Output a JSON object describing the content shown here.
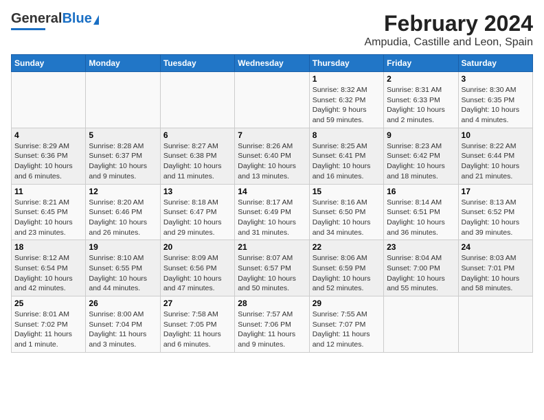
{
  "header": {
    "logo_general": "General",
    "logo_blue": "Blue",
    "title": "February 2024",
    "subtitle": "Ampudia, Castille and Leon, Spain"
  },
  "calendar": {
    "days_of_week": [
      "Sunday",
      "Monday",
      "Tuesday",
      "Wednesday",
      "Thursday",
      "Friday",
      "Saturday"
    ],
    "weeks": [
      [
        {
          "day": "",
          "info": ""
        },
        {
          "day": "",
          "info": ""
        },
        {
          "day": "",
          "info": ""
        },
        {
          "day": "",
          "info": ""
        },
        {
          "day": "1",
          "info": "Sunrise: 8:32 AM\nSunset: 6:32 PM\nDaylight: 9 hours\nand 59 minutes."
        },
        {
          "day": "2",
          "info": "Sunrise: 8:31 AM\nSunset: 6:33 PM\nDaylight: 10 hours\nand 2 minutes."
        },
        {
          "day": "3",
          "info": "Sunrise: 8:30 AM\nSunset: 6:35 PM\nDaylight: 10 hours\nand 4 minutes."
        }
      ],
      [
        {
          "day": "4",
          "info": "Sunrise: 8:29 AM\nSunset: 6:36 PM\nDaylight: 10 hours\nand 6 minutes."
        },
        {
          "day": "5",
          "info": "Sunrise: 8:28 AM\nSunset: 6:37 PM\nDaylight: 10 hours\nand 9 minutes."
        },
        {
          "day": "6",
          "info": "Sunrise: 8:27 AM\nSunset: 6:38 PM\nDaylight: 10 hours\nand 11 minutes."
        },
        {
          "day": "7",
          "info": "Sunrise: 8:26 AM\nSunset: 6:40 PM\nDaylight: 10 hours\nand 13 minutes."
        },
        {
          "day": "8",
          "info": "Sunrise: 8:25 AM\nSunset: 6:41 PM\nDaylight: 10 hours\nand 16 minutes."
        },
        {
          "day": "9",
          "info": "Sunrise: 8:23 AM\nSunset: 6:42 PM\nDaylight: 10 hours\nand 18 minutes."
        },
        {
          "day": "10",
          "info": "Sunrise: 8:22 AM\nSunset: 6:44 PM\nDaylight: 10 hours\nand 21 minutes."
        }
      ],
      [
        {
          "day": "11",
          "info": "Sunrise: 8:21 AM\nSunset: 6:45 PM\nDaylight: 10 hours\nand 23 minutes."
        },
        {
          "day": "12",
          "info": "Sunrise: 8:20 AM\nSunset: 6:46 PM\nDaylight: 10 hours\nand 26 minutes."
        },
        {
          "day": "13",
          "info": "Sunrise: 8:18 AM\nSunset: 6:47 PM\nDaylight: 10 hours\nand 29 minutes."
        },
        {
          "day": "14",
          "info": "Sunrise: 8:17 AM\nSunset: 6:49 PM\nDaylight: 10 hours\nand 31 minutes."
        },
        {
          "day": "15",
          "info": "Sunrise: 8:16 AM\nSunset: 6:50 PM\nDaylight: 10 hours\nand 34 minutes."
        },
        {
          "day": "16",
          "info": "Sunrise: 8:14 AM\nSunset: 6:51 PM\nDaylight: 10 hours\nand 36 minutes."
        },
        {
          "day": "17",
          "info": "Sunrise: 8:13 AM\nSunset: 6:52 PM\nDaylight: 10 hours\nand 39 minutes."
        }
      ],
      [
        {
          "day": "18",
          "info": "Sunrise: 8:12 AM\nSunset: 6:54 PM\nDaylight: 10 hours\nand 42 minutes."
        },
        {
          "day": "19",
          "info": "Sunrise: 8:10 AM\nSunset: 6:55 PM\nDaylight: 10 hours\nand 44 minutes."
        },
        {
          "day": "20",
          "info": "Sunrise: 8:09 AM\nSunset: 6:56 PM\nDaylight: 10 hours\nand 47 minutes."
        },
        {
          "day": "21",
          "info": "Sunrise: 8:07 AM\nSunset: 6:57 PM\nDaylight: 10 hours\nand 50 minutes."
        },
        {
          "day": "22",
          "info": "Sunrise: 8:06 AM\nSunset: 6:59 PM\nDaylight: 10 hours\nand 52 minutes."
        },
        {
          "day": "23",
          "info": "Sunrise: 8:04 AM\nSunset: 7:00 PM\nDaylight: 10 hours\nand 55 minutes."
        },
        {
          "day": "24",
          "info": "Sunrise: 8:03 AM\nSunset: 7:01 PM\nDaylight: 10 hours\nand 58 minutes."
        }
      ],
      [
        {
          "day": "25",
          "info": "Sunrise: 8:01 AM\nSunset: 7:02 PM\nDaylight: 11 hours\nand 1 minute."
        },
        {
          "day": "26",
          "info": "Sunrise: 8:00 AM\nSunset: 7:04 PM\nDaylight: 11 hours\nand 3 minutes."
        },
        {
          "day": "27",
          "info": "Sunrise: 7:58 AM\nSunset: 7:05 PM\nDaylight: 11 hours\nand 6 minutes."
        },
        {
          "day": "28",
          "info": "Sunrise: 7:57 AM\nSunset: 7:06 PM\nDaylight: 11 hours\nand 9 minutes."
        },
        {
          "day": "29",
          "info": "Sunrise: 7:55 AM\nSunset: 7:07 PM\nDaylight: 11 hours\nand 12 minutes."
        },
        {
          "day": "",
          "info": ""
        },
        {
          "day": "",
          "info": ""
        }
      ]
    ]
  }
}
